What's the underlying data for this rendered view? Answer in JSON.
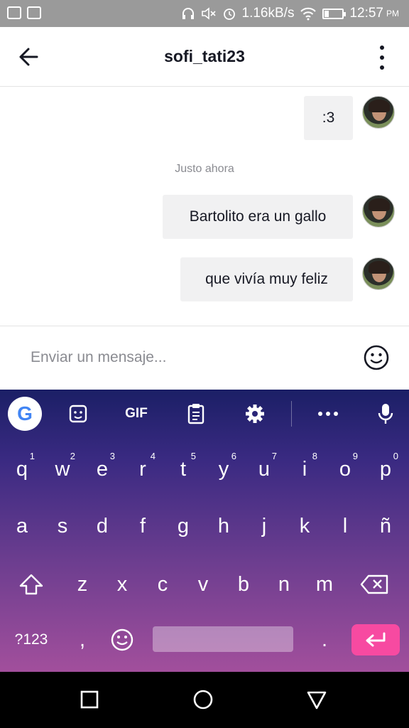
{
  "status_bar": {
    "speed": "1.16kB/s",
    "time": "12:57",
    "ampm": "PM",
    "battery_level": 0.2
  },
  "header": {
    "title": "sofi_tati23"
  },
  "messages": [
    {
      "text": ":3"
    },
    {
      "text": "Bartolito era un gallo"
    },
    {
      "text": "que vivía muy feliz"
    }
  ],
  "timestamp": "Justo ahora",
  "input": {
    "placeholder": "Enviar un mensaje..."
  },
  "keyboard": {
    "google": "G",
    "gif": "GIF",
    "row1": [
      "q",
      "w",
      "e",
      "r",
      "t",
      "y",
      "u",
      "i",
      "o",
      "p"
    ],
    "row1_hints": [
      "1",
      "2",
      "3",
      "4",
      "5",
      "6",
      "7",
      "8",
      "9",
      "0"
    ],
    "row2": [
      "a",
      "s",
      "d",
      "f",
      "g",
      "h",
      "j",
      "k",
      "l",
      "ñ"
    ],
    "row3": [
      "z",
      "x",
      "c",
      "v",
      "b",
      "n",
      "m"
    ],
    "sym": "?123",
    "comma": ",",
    "period": "."
  },
  "colors": {
    "accent": "#f74aa1",
    "bubble": "#f1f1f2",
    "keyboard_top": "#1b1f66",
    "keyboard_bottom": "#a24f9c"
  }
}
